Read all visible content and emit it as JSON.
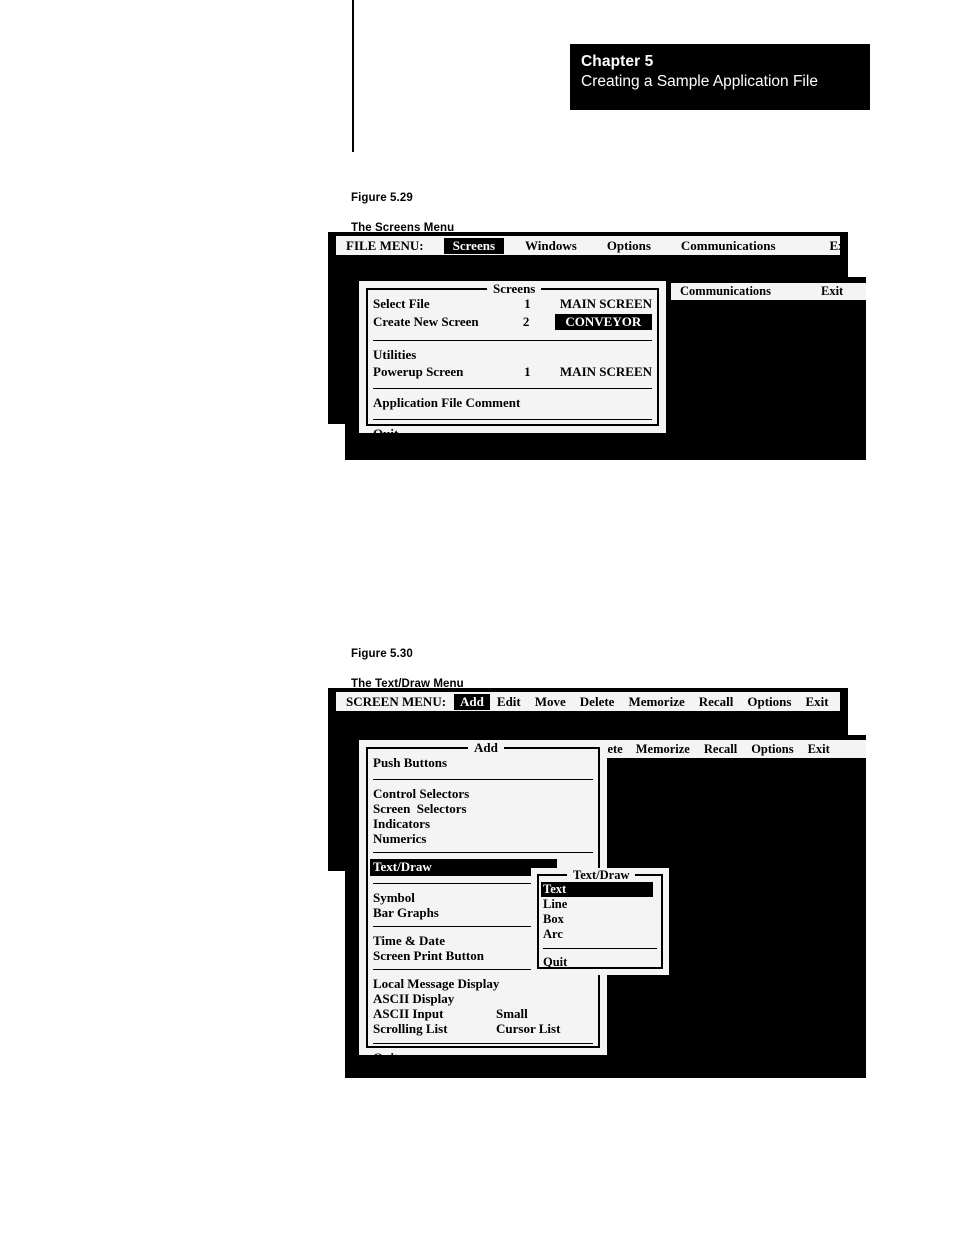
{
  "page": {
    "chapter_number": "Chapter 5",
    "chapter_title": "Creating a Sample Application File"
  },
  "figure_529": {
    "caption_number": "Figure 5.29",
    "caption_title": "The Screens Menu",
    "file_menu_bar": {
      "lead_label": "FILE MENU:",
      "items": [
        {
          "label": "Screens",
          "selected": true
        },
        {
          "label": "Windows",
          "selected": false
        },
        {
          "label": "Options",
          "selected": false
        },
        {
          "label": "Communications",
          "selected": false
        },
        {
          "label": "Exit",
          "selected": false
        }
      ]
    },
    "background_menu_bar": {
      "items": [
        {
          "label": "Communications"
        },
        {
          "label": "Exit"
        }
      ]
    },
    "screens_dialog": {
      "title": "Screens",
      "rows": [
        {
          "label": "Select File",
          "number": "1",
          "value": "MAIN SCREEN",
          "value_selected": false
        },
        {
          "label": "Create New Screen",
          "number": "2",
          "value": "CONVEYOR",
          "value_selected": true
        },
        {
          "label": "Utilities",
          "number": "",
          "value": "",
          "value_selected": false
        },
        {
          "label": "Powerup Screen",
          "number": "1",
          "value": "MAIN SCREEN",
          "value_selected": false
        },
        {
          "label": "Application File Comment",
          "number": "",
          "value": "",
          "value_selected": false
        },
        {
          "label": "Quit",
          "number": "",
          "value": "",
          "value_selected": false
        }
      ]
    }
  },
  "figure_530": {
    "caption_number": "Figure 5.30",
    "caption_title": "The Text/Draw Menu",
    "screen_menu_bar": {
      "lead_label": "SCREEN MENU:",
      "items": [
        {
          "label": "Add",
          "selected": true
        },
        {
          "label": "Edit",
          "selected": false
        },
        {
          "label": "Move",
          "selected": false
        },
        {
          "label": "Delete",
          "selected": false
        },
        {
          "label": "Memorize",
          "selected": false
        },
        {
          "label": "Recall",
          "selected": false
        },
        {
          "label": "Options",
          "selected": false
        },
        {
          "label": "Exit",
          "selected": false
        }
      ]
    },
    "background_menu_bar": {
      "items": [
        {
          "label": "lete"
        },
        {
          "label": "Memorize"
        },
        {
          "label": "Recall"
        },
        {
          "label": "Options"
        },
        {
          "label": "Exit"
        }
      ]
    },
    "add_dialog": {
      "title": "Add",
      "rows": [
        {
          "label": "Push Buttons",
          "value": "",
          "selected": false
        },
        {
          "label": "Control Selectors",
          "value": "",
          "selected": false
        },
        {
          "label": "Screen  Selectors",
          "value": "",
          "selected": false
        },
        {
          "label": "Indicators",
          "value": "",
          "selected": false
        },
        {
          "label": "Numerics",
          "value": "",
          "selected": false
        },
        {
          "label": "Text/Draw",
          "value": "",
          "selected": true
        },
        {
          "label": "Symbol",
          "value": "",
          "selected": false
        },
        {
          "label": "Bar Graphs",
          "value": "",
          "selected": false
        },
        {
          "label": "Time & Date",
          "value": "",
          "selected": false
        },
        {
          "label": "Screen Print Button",
          "value": "",
          "selected": false
        },
        {
          "label": "Local Message Display",
          "value": "",
          "selected": false
        },
        {
          "label": "ASCII Display",
          "value": "",
          "selected": false
        },
        {
          "label": "ASCII Input",
          "value": "Small",
          "selected": false
        },
        {
          "label": "Scrolling List",
          "value": "Cursor List",
          "selected": false
        },
        {
          "label": "Quit",
          "value": "",
          "selected": false
        }
      ]
    },
    "textdraw_dialog": {
      "title": "Text/Draw",
      "rows": [
        {
          "label": "Text",
          "selected": true
        },
        {
          "label": "Line",
          "selected": false
        },
        {
          "label": "Box",
          "selected": false
        },
        {
          "label": "Arc",
          "selected": false
        },
        {
          "label": "Quit",
          "selected": false
        }
      ]
    }
  },
  "colors": {
    "ink": "#000000",
    "paper": "#ffffff",
    "panel": "#f4f4f4",
    "highlight_bg": "#000000",
    "highlight_fg": "#ffffff"
  }
}
